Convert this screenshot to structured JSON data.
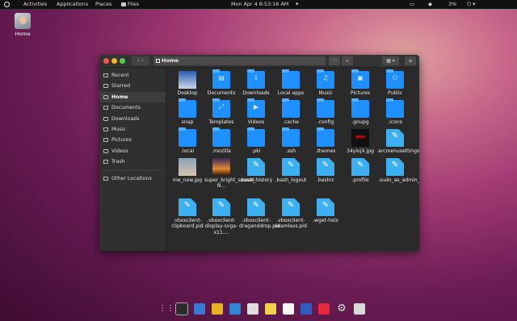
{
  "topbar": {
    "activities": "Activities",
    "applications": "Applications",
    "places": "Places",
    "files": "Files",
    "datetime": "Mon Apr 4  8:53:16 AM",
    "battery": "3%"
  },
  "desktop": {
    "home_label": "Home"
  },
  "window": {
    "path": "Home",
    "sidebar": [
      "Recent",
      "Starred",
      "Home",
      "Documents",
      "Downloads",
      "Music",
      "Pictures",
      "Videos",
      "Trash",
      "Other Locations"
    ],
    "files": [
      {
        "name": "Desktop",
        "kind": "img-desk",
        "glyph": ""
      },
      {
        "name": "Documents",
        "kind": "folder",
        "glyph": "▤"
      },
      {
        "name": "Downloads",
        "kind": "folder",
        "glyph": "⇩"
      },
      {
        "name": "Local apps",
        "kind": "folder",
        "glyph": ""
      },
      {
        "name": "Music",
        "kind": "folder",
        "glyph": "♫"
      },
      {
        "name": "Pictures",
        "kind": "folder",
        "glyph": "▣"
      },
      {
        "name": "Public",
        "kind": "folder",
        "glyph": "⚇"
      },
      {
        "name": "snap",
        "kind": "folder",
        "glyph": ""
      },
      {
        "name": "Templates",
        "kind": "folder",
        "glyph": "⤢"
      },
      {
        "name": "Videos",
        "kind": "folder",
        "glyph": "▶"
      },
      {
        "name": ".cache",
        "kind": "folder",
        "glyph": ""
      },
      {
        "name": ".config",
        "kind": "folder",
        "glyph": ""
      },
      {
        "name": ".gnupg",
        "kind": "folder",
        "glyph": ""
      },
      {
        "name": ".icons",
        "kind": "folder",
        "glyph": ""
      },
      {
        "name": ".local",
        "kind": "folder",
        "glyph": ""
      },
      {
        "name": ".mozilla",
        "kind": "folder",
        "glyph": ""
      },
      {
        "name": ".pki",
        "kind": "folder",
        "glyph": ""
      },
      {
        "name": ".ssh",
        "kind": "folder",
        "glyph": ""
      },
      {
        "name": ".themes",
        "kind": "folder",
        "glyph": ""
      },
      {
        "name": "34ylojX.jpg",
        "kind": "img-dark",
        "glyph": ""
      },
      {
        "name": "arcmenusettings",
        "kind": "doc",
        "glyph": "✎"
      },
      {
        "name": "me_new.jpg",
        "kind": "img-face",
        "glyph": ""
      },
      {
        "name": "super_bright_sunset-N...",
        "kind": "img-sunset",
        "glyph": ""
      },
      {
        "name": ".bash_history",
        "kind": "doc",
        "glyph": "✎"
      },
      {
        "name": ".bash_logout",
        "kind": "doc",
        "glyph": "✎"
      },
      {
        "name": ".bashrc",
        "kind": "doc",
        "glyph": "✎"
      },
      {
        "name": ".profile",
        "kind": "doc",
        "glyph": "✎"
      },
      {
        "name": ".sudo_as_admin_successful",
        "kind": "doc",
        "glyph": "✎"
      },
      {
        "name": ".vboxclient-clipboard.pid",
        "kind": "doc",
        "glyph": "✎"
      },
      {
        "name": ".vboxclient-display-svga-x11....",
        "kind": "doc",
        "glyph": "✎"
      },
      {
        "name": ".vboxclient-draganddrop.pid",
        "kind": "doc",
        "glyph": "✎"
      },
      {
        "name": ".vboxclient-seamless.pid",
        "kind": "doc",
        "glyph": "✎"
      },
      {
        "name": ".wget-hsts",
        "kind": "doc",
        "glyph": "✎"
      }
    ]
  },
  "dock": [
    {
      "name": "show-apps-icon",
      "color": "#222"
    },
    {
      "name": "terminal-icon",
      "color": "#2b2b2b"
    },
    {
      "name": "text-editor-icon",
      "color": "#3a79d6"
    },
    {
      "name": "chrome-icon",
      "color": "#e7b321"
    },
    {
      "name": "vscode-icon",
      "color": "#2f86d6"
    },
    {
      "name": "screenshot-icon",
      "color": "#dddddd"
    },
    {
      "name": "notes-icon",
      "color": "#f1d14b"
    },
    {
      "name": "document-viewer-icon",
      "color": "#f4f4f4"
    },
    {
      "name": "image-viewer-icon",
      "color": "#2d5ebd"
    },
    {
      "name": "camera-icon",
      "color": "#e6283c"
    },
    {
      "name": "settings-icon",
      "color": "#cfcfcf"
    },
    {
      "name": "software-icon",
      "color": "#d9d9d9"
    }
  ]
}
